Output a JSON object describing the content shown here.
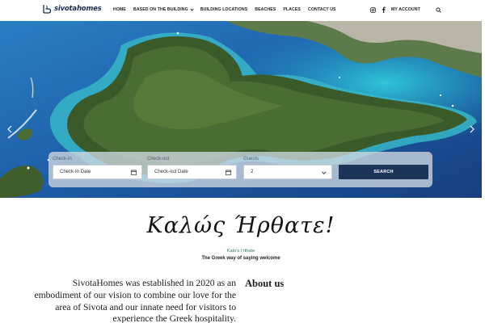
{
  "header": {
    "logo_text": "sivotahomes",
    "nav": [
      {
        "label": "HOME"
      },
      {
        "label": "BASED ON THE BUILDING"
      },
      {
        "label": "BUILDING LOCATIONS"
      },
      {
        "label": "BEACHES"
      },
      {
        "label": "PLACES"
      },
      {
        "label": "CONTACT US"
      }
    ],
    "account_label": "MY ACCOUNT",
    "icons": [
      "instagram-icon",
      "facebook-icon",
      "search-icon"
    ]
  },
  "booking": {
    "checkin_label": "Check-in",
    "checkin_placeholder": "Check-In Date",
    "checkout_label": "Check-out",
    "checkout_placeholder": "Check-out Date",
    "guests_label": "Guests",
    "guests_value": "2",
    "search_label": "SEARCH"
  },
  "welcome": {
    "title": "Καλώς Ήρθατε!",
    "transliteration": "Kalo's I'rthate",
    "meaning": "The Greek way of saying welcome"
  },
  "about": {
    "text": "SivotaHomes was established in 2020 as an embodiment of our vision to combine our love for the area of Sivota and our innate need for visitors to experience the Greek hospitality.",
    "title": "About us"
  },
  "colors": {
    "brand": "#1a2c4e",
    "search_button": "#1d3559",
    "accent_green": "#2f7a63"
  }
}
